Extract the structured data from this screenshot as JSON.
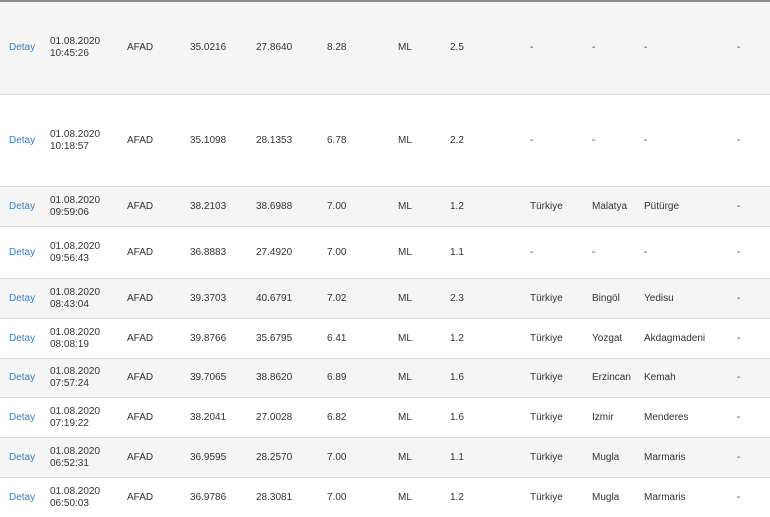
{
  "rows": [
    {
      "link": "Detay",
      "date": "01.08.2020",
      "time": "10:45:26",
      "agency": "AFAD",
      "lat": "35.0216",
      "lon": "27.8640",
      "depth": "8.28",
      "type": "ML",
      "mag": "2.5",
      "country": "-",
      "city": "-",
      "district": "-",
      "other": "-"
    },
    {
      "link": "Detay",
      "date": "01.08.2020",
      "time": "10:18:57",
      "agency": "AFAD",
      "lat": "35.1098",
      "lon": "28.1353",
      "depth": "6.78",
      "type": "ML",
      "mag": "2.2",
      "country": "-",
      "city": "-",
      "district": "-",
      "other": "-"
    },
    {
      "link": "Detay",
      "date": "01.08.2020",
      "time": "09:59:06",
      "agency": "AFAD",
      "lat": "38.2103",
      "lon": "38.6988",
      "depth": "7.00",
      "type": "ML",
      "mag": "1.2",
      "country": "Türkiye",
      "city": "Malatya",
      "district": "Pütürge",
      "other": "-"
    },
    {
      "link": "Detay",
      "date": "01.08.2020",
      "time": "09:56:43",
      "agency": "AFAD",
      "lat": "36.8883",
      "lon": "27.4920",
      "depth": "7.00",
      "type": "ML",
      "mag": "1.1",
      "country": "-",
      "city": "-",
      "district": "-",
      "other": "-"
    },
    {
      "link": "Detay",
      "date": "01.08.2020",
      "time": "08:43:04",
      "agency": "AFAD",
      "lat": "39.3703",
      "lon": "40.6791",
      "depth": "7.02",
      "type": "ML",
      "mag": "2.3",
      "country": "Türkiye",
      "city": "Bingöl",
      "district": "Yedisu",
      "other": "-"
    },
    {
      "link": "Detay",
      "date": "01.08.2020",
      "time": "08:08:19",
      "agency": "AFAD",
      "lat": "39.8766",
      "lon": "35.6795",
      "depth": "6.41",
      "type": "ML",
      "mag": "1.2",
      "country": "Türkiye",
      "city": "Yozgat",
      "district": "Akdagmadeni",
      "other": "-"
    },
    {
      "link": "Detay",
      "date": "01.08.2020",
      "time": "07:57:24",
      "agency": "AFAD",
      "lat": "39.7065",
      "lon": "38.8620",
      "depth": "6.89",
      "type": "ML",
      "mag": "1.6",
      "country": "Türkiye",
      "city": "Erzincan",
      "district": "Kemah",
      "other": "-"
    },
    {
      "link": "Detay",
      "date": "01.08.2020",
      "time": "07:19:22",
      "agency": "AFAD",
      "lat": "38.2041",
      "lon": "27.0028",
      "depth": "6.82",
      "type": "ML",
      "mag": "1.6",
      "country": "Türkiye",
      "city": "Izmir",
      "district": "Menderes",
      "other": "-"
    },
    {
      "link": "Detay",
      "date": "01.08.2020",
      "time": "06:52:31",
      "agency": "AFAD",
      "lat": "36.9595",
      "lon": "28.2570",
      "depth": "7.00",
      "type": "ML",
      "mag": "1.1",
      "country": "Türkiye",
      "city": "Mugla",
      "district": "Marmaris",
      "other": "-"
    },
    {
      "link": "Detay",
      "date": "01.08.2020",
      "time": "06:50:03",
      "agency": "AFAD",
      "lat": "36.9786",
      "lon": "28.3081",
      "depth": "7.00",
      "type": "ML",
      "mag": "1.2",
      "country": "Türkiye",
      "city": "Mugla",
      "district": "Marmaris",
      "other": "-"
    }
  ]
}
